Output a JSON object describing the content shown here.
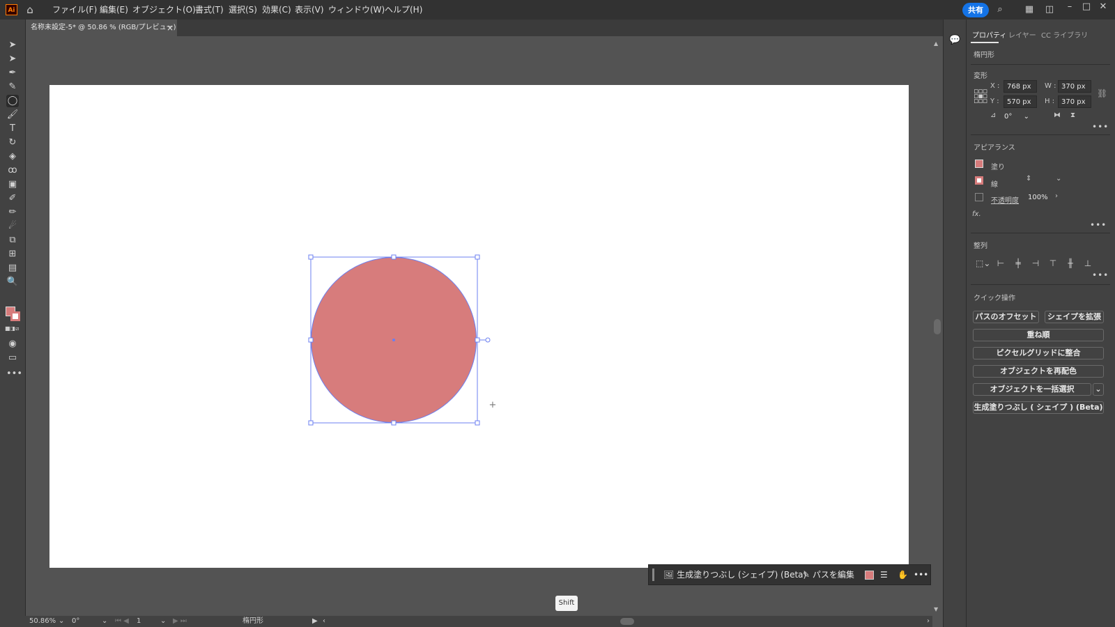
{
  "app": {
    "logo": "Ai",
    "home_icon": "home-icon"
  },
  "menu": [
    "ファイル(F)",
    "編集(E)",
    "オブジェクト(O)",
    "書式(T)",
    "選択(S)",
    "効果(C)",
    "表示(V)",
    "ウィンドウ(W)",
    "ヘルプ(H)"
  ],
  "topright": {
    "share": "共有",
    "icons": [
      "search-icon",
      "arrange-icon",
      "workspace-icon",
      "minimize-icon",
      "maximize-icon",
      "close-icon"
    ],
    "window_glyphs": [
      "–",
      "□",
      "✕"
    ]
  },
  "document_tab": {
    "title": "名称未設定-5* @ 50.86 % (RGB/プレビュー)",
    "close": "×"
  },
  "tools": [
    "selection-tool",
    "direct-selection-tool",
    "pen-tool",
    "curvature-tool",
    "ellipse-tool",
    "paintbrush-tool",
    "type-tool",
    "rotate-tool",
    "eraser-tool",
    "lasso-tool",
    "gradient-tool",
    "eyedropper-tool",
    "pencil-tool",
    "puppet-warp-tool",
    "shape-builder-tool",
    "artboard-tool",
    "chart-tool",
    "zoom-tool"
  ],
  "tool_glyphs": [
    "➤",
    "➤",
    "✒",
    "✎",
    "◯",
    "🖌",
    "T",
    "↻",
    "◈",
    "ꝏ",
    "▣",
    "✐",
    "✏",
    "☄",
    "⧉",
    "⊞",
    "▤",
    "🔍"
  ],
  "toolbar_more": "•••",
  "colors": {
    "fill": "#d77c7c",
    "selection": "#6b7ff0",
    "accent": "#1473e6"
  },
  "panel": {
    "tabs": [
      "プロパティ",
      "レイヤー",
      "CC ライブラリ"
    ],
    "object_type": "楕円形",
    "transform": {
      "title": "変形",
      "x_label": "X :",
      "x": "768 px",
      "y_label": "Y :",
      "y": "570 px",
      "w_label": "W :",
      "w": "370 px",
      "h_label": "H :",
      "h": "370 px",
      "angle": "0°"
    },
    "appearance": {
      "title": "アピアランス",
      "fill_label": "塗り",
      "stroke_label": "線",
      "opacity_label": "不透明度",
      "opacity": "100%",
      "fx": "fx."
    },
    "align": {
      "title": "整列"
    },
    "quick_actions": {
      "title": "クイック操作",
      "offset_path": "パスのオフセット",
      "expand_shape": "シェイプを拡張",
      "arrange": "重ね順",
      "pixel_grid": "ピクセルグリッドに整合",
      "recolor": "オブジェクトを再配色",
      "select_same": "オブジェクトを一括選択",
      "gen_fill": "生成塗りつぶし ( シェイプ ) (Beta)"
    },
    "more": "•••"
  },
  "context_bar": {
    "gen_fill": "生成塗りつぶし (シェイプ) (Beta)",
    "edit_path": "パスを編集",
    "more": "•••"
  },
  "key_hint": "Shift",
  "status": {
    "zoom": "50.86%",
    "angle": "0°",
    "artboard": "1",
    "tool": "楕円形"
  }
}
